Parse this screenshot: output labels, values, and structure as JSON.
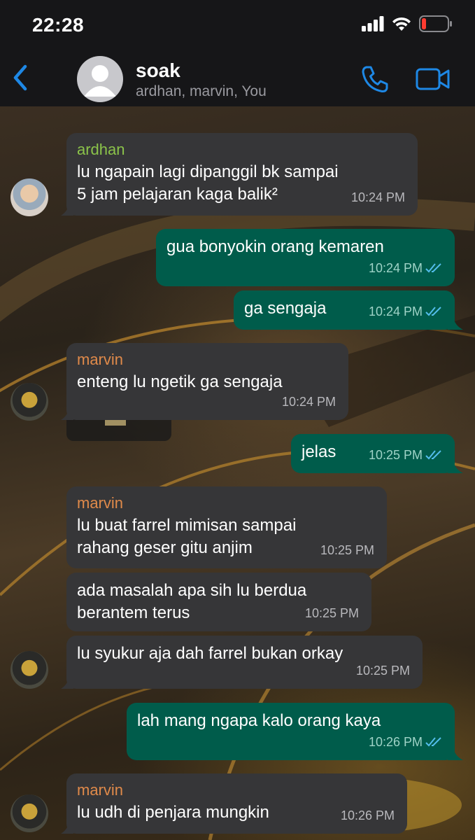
{
  "status": {
    "time": "22:28"
  },
  "chat": {
    "title": "soak",
    "members": "ardhan, marvin, You"
  },
  "colors": {
    "accent": "#1e88e5",
    "outgoing": "#005c4b",
    "incoming": "#363638",
    "ardhan": "#8bc34a",
    "marvin": "#e08a4a"
  },
  "messages": [
    {
      "from": "ardhan",
      "text": "lu ngapain lagi dipanggil bk sampai\n5 jam pelajaran kaga balik²",
      "time": "10:24 PM"
    },
    {
      "from": "You",
      "text": "gua bonyokin orang kemaren",
      "time": "10:24 PM"
    },
    {
      "from": "You",
      "text": "ga sengaja",
      "time": "10:24 PM"
    },
    {
      "from": "marvin",
      "text": "enteng lu ngetik ga sengaja",
      "time": "10:24 PM"
    },
    {
      "from": "You",
      "text": "jelas",
      "time": "10:25 PM"
    },
    {
      "from": "marvin",
      "text": "lu buat farrel mimisan sampai\nrahang geser gitu anjim",
      "time": "10:25 PM"
    },
    {
      "from": "marvin",
      "text": "ada masalah apa sih lu berdua\nberantem terus",
      "time": "10:25 PM"
    },
    {
      "from": "marvin",
      "text": "lu syukur aja dah farrel bukan orkay",
      "time": "10:25 PM"
    },
    {
      "from": "You",
      "text": "lah mang ngapa kalo orang kaya",
      "time": "10:26 PM"
    },
    {
      "from": "marvin",
      "text": "lu udh di penjara mungkin",
      "time": "10:26 PM"
    }
  ]
}
